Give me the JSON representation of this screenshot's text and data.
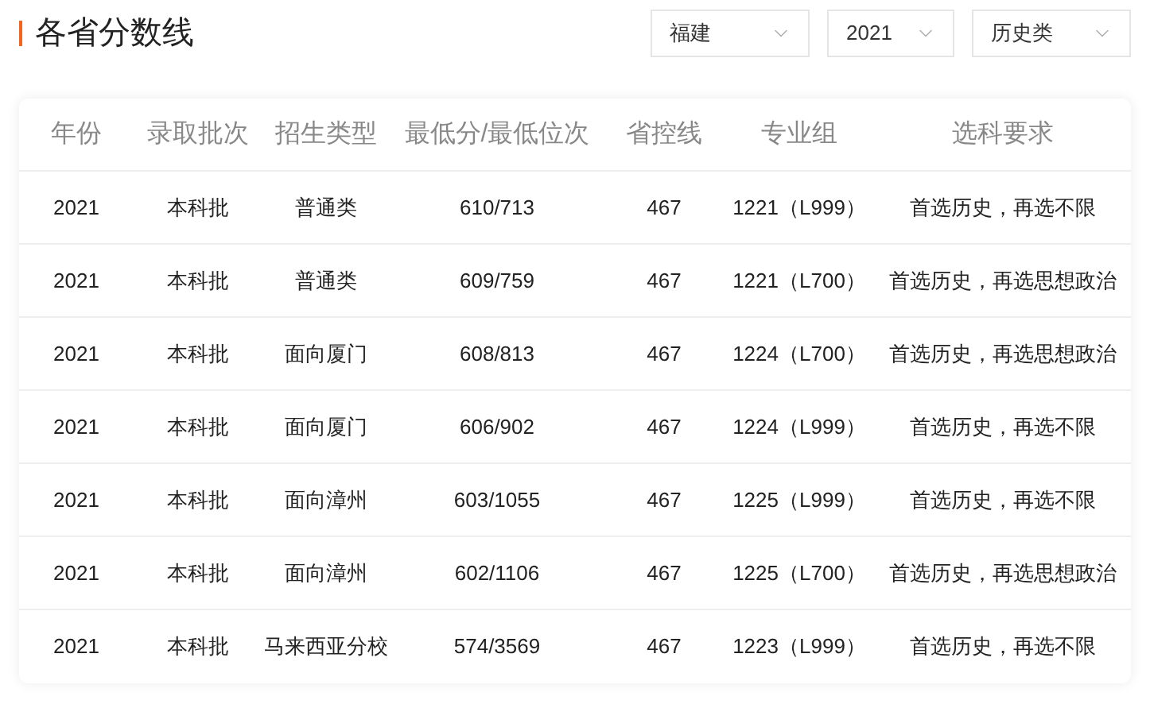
{
  "title": "各省分数线",
  "filters": [
    {
      "value": "福建"
    },
    {
      "value": "2021"
    },
    {
      "value": "历史类"
    }
  ],
  "table": {
    "columns": [
      "年份",
      "录取批次",
      "招生类型",
      "最低分/最低位次",
      "省控线",
      "专业组",
      "选科要求"
    ],
    "rows": [
      [
        "2021",
        "本科批",
        "普通类",
        "610/713",
        "467",
        "1221（L999）",
        "首选历史，再选不限"
      ],
      [
        "2021",
        "本科批",
        "普通类",
        "609/759",
        "467",
        "1221（L700）",
        "首选历史，再选思想政治"
      ],
      [
        "2021",
        "本科批",
        "面向厦门",
        "608/813",
        "467",
        "1224（L700）",
        "首选历史，再选思想政治"
      ],
      [
        "2021",
        "本科批",
        "面向厦门",
        "606/902",
        "467",
        "1224（L999）",
        "首选历史，再选不限"
      ],
      [
        "2021",
        "本科批",
        "面向漳州",
        "603/1055",
        "467",
        "1225（L999）",
        "首选历史，再选不限"
      ],
      [
        "2021",
        "本科批",
        "面向漳州",
        "602/1106",
        "467",
        "1225（L700）",
        "首选历史，再选思想政治"
      ],
      [
        "2021",
        "本科批",
        "马来西亚分校",
        "574/3569",
        "467",
        "1223（L999）",
        "首选历史，再选不限"
      ]
    ]
  }
}
